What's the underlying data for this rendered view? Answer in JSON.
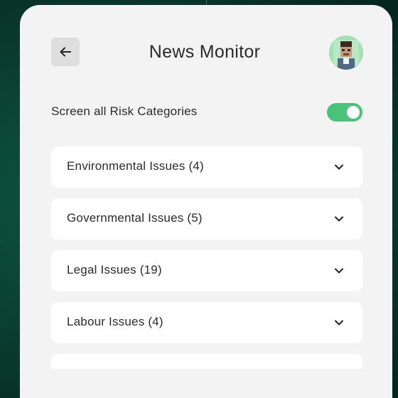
{
  "header": {
    "title": "News Monitor",
    "back_icon": "arrow-left-icon",
    "avatar_icon": "user-avatar"
  },
  "screen_all": {
    "label": "Screen all Risk Categories",
    "enabled": true,
    "toggle_color": "#49c27a"
  },
  "categories": [
    {
      "label": "Environmental Issues (4)"
    },
    {
      "label": "Governmental Issues (5)"
    },
    {
      "label": "Legal Issues (19)"
    },
    {
      "label": "Labour Issues (4)"
    },
    {
      "label": ""
    }
  ],
  "colors": {
    "background": "#0a3d30",
    "panel": "#f3f3f3",
    "card": "#ffffff",
    "accent": "#49c27a"
  }
}
